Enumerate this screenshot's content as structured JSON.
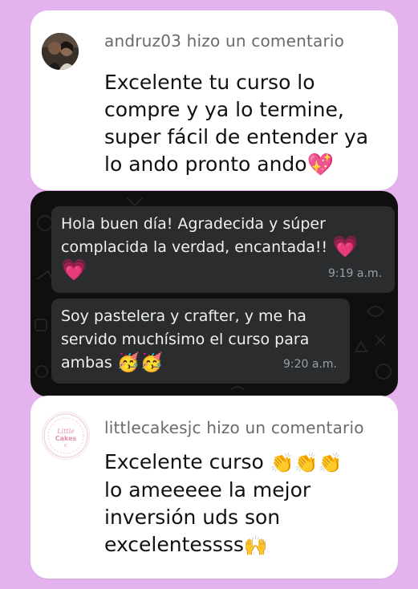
{
  "cards": [
    {
      "header": "andruz03 hizo un comentario",
      "lines": [
        "Excelente tu curso lo",
        "compre y ya lo termine,",
        "super fácil de entender ya",
        "lo ando pronto ando"
      ],
      "emoji_end": "💖"
    },
    {
      "header": "littlecakesjc hizo un comentario",
      "avatar_logo_text": "Little Cakes JC",
      "lines": [
        "Excelente curso",
        "lo ameeeee la mejor",
        "inversión uds son",
        "excelentessss"
      ],
      "line1_emoji": "👏👏👏",
      "emoji_end": "🙌"
    }
  ],
  "chat": {
    "messages": [
      {
        "lines": [
          "Hola buen día! Agradecida y súper",
          "complacida la verdad, encantada!!"
        ],
        "emoji_a": "💗",
        "emoji_b": "💗",
        "time": "9:19 a.m."
      },
      {
        "lines": [
          "Soy pastelera y crafter, y me ha",
          "servido muchísimo el curso para",
          "ambas"
        ],
        "emoji": "🥳🥳",
        "time": "9:20 a.m."
      }
    ]
  },
  "colors": {
    "page_background": "#e4b3ee",
    "card_background": "#ffffff",
    "chat_background": "#0f0f0f",
    "bubble_background": "#2a2c2e"
  }
}
